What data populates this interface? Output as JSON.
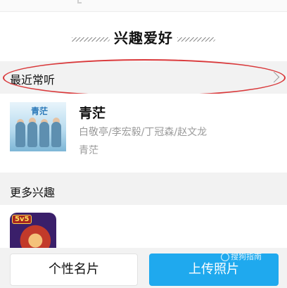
{
  "section_title": "兴趣爱好",
  "recent": {
    "label": "最近常听",
    "song": {
      "title": "青茫",
      "artists": "白敬亭/李宏毅/丁冠森/赵文龙",
      "album": "青茫",
      "cover_text": "青茫"
    }
  },
  "more": {
    "label": "更多兴趣",
    "game_badge": "5v5"
  },
  "buttons": {
    "profile_card": "个性名片",
    "upload_photo": "上传照片"
  },
  "watermark": "搜狗指南",
  "colors": {
    "accent_blue": "#1fa9ee",
    "highlight_red": "#d9383a"
  }
}
